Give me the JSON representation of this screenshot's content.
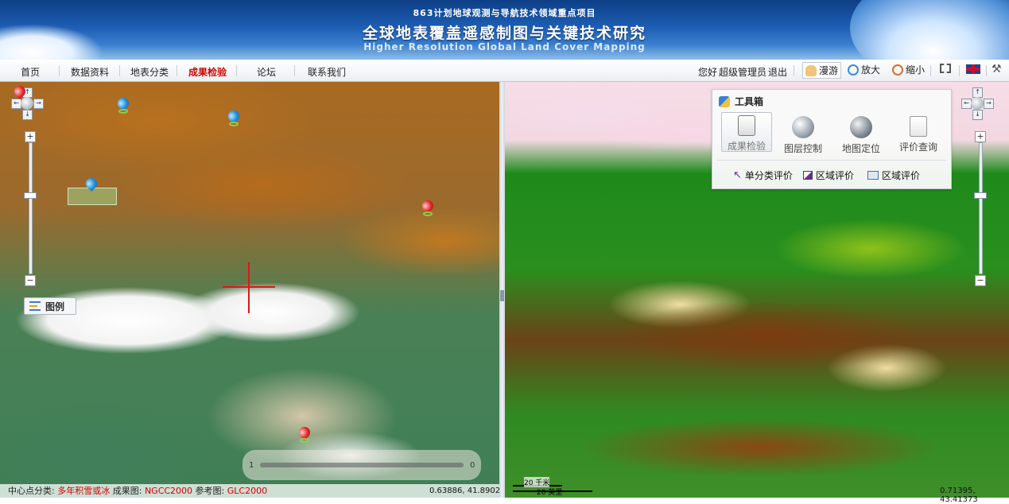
{
  "banner": {
    "subtitle": "863计划地球观测与导航技术领域重点项目",
    "title": "全球地表覆盖遥感制图与关键技术研究",
    "title_en": "Higher Resolution Global Land Cover Mapping"
  },
  "nav": {
    "items": [
      {
        "label": "首页"
      },
      {
        "label": "数据资料"
      },
      {
        "label": "地表分类"
      },
      {
        "label": "成果检验",
        "active": true
      },
      {
        "label": "论坛"
      },
      {
        "label": "联系我们"
      }
    ]
  },
  "user": {
    "greeting": "您好",
    "name": "超级管理员",
    "logout": "退出"
  },
  "toolbar": {
    "pan": "漫游",
    "zoom_in": "放大",
    "zoom_out": "缩小"
  },
  "left_map": {
    "legend_label": "图例",
    "timeline_start": "1",
    "timeline_end": "0"
  },
  "status": {
    "center_label": "中心点分类:",
    "center_value": "多年积雪或冰",
    "result_label": "成果图:",
    "result_value": "NGCC2000",
    "ref_label": "参考图:",
    "ref_value": "GLC2000",
    "left_coord": "0.63886, 41.89023",
    "right_coord": "0.71395, 43.41373"
  },
  "scale": {
    "top": "20 千米",
    "bottom": "20 英里"
  },
  "toolbox": {
    "title": "工具箱",
    "tools": [
      {
        "label": "成果检验",
        "icon": "clipboard-check-icon"
      },
      {
        "label": "图层控制",
        "icon": "layers-globe-icon"
      },
      {
        "label": "地图定位",
        "icon": "globe-locate-icon"
      },
      {
        "label": "评价查询",
        "icon": "document-edit-icon"
      }
    ],
    "evals": [
      {
        "label": "单分类评价"
      },
      {
        "label": "区域评价"
      },
      {
        "label": "区域评价"
      }
    ]
  },
  "colors": {
    "nav_active": "#d40000",
    "banner_blue": "#1d5db3",
    "marker_red": "#e42626",
    "marker_blue": "#1d8fe0"
  }
}
